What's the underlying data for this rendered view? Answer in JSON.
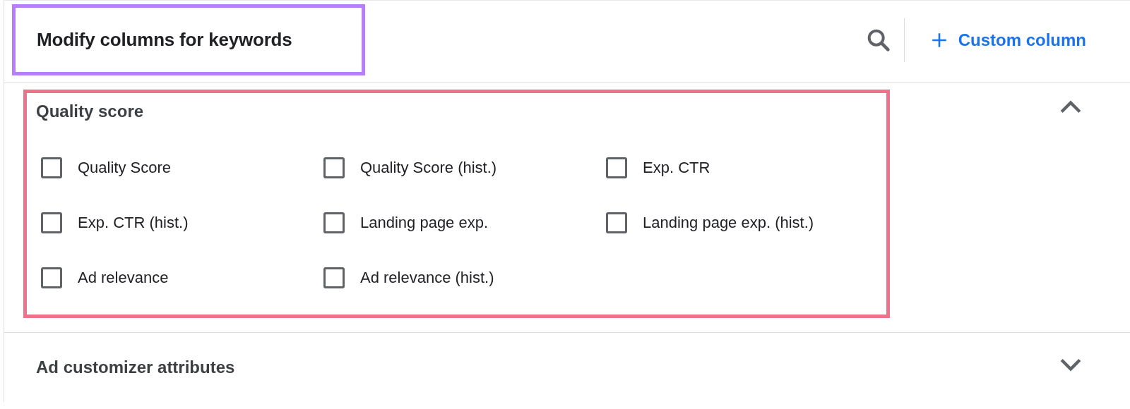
{
  "header": {
    "title": "Modify columns for keywords",
    "custom_column_button": "Custom column",
    "highlighted": true
  },
  "sections": [
    {
      "title": "Quality score",
      "expanded": true,
      "highlighted": true,
      "options": [
        {
          "label": "Quality Score",
          "checked": false
        },
        {
          "label": "Quality Score (hist.)",
          "checked": false
        },
        {
          "label": "Exp. CTR",
          "checked": false
        },
        {
          "label": "Exp. CTR (hist.)",
          "checked": false
        },
        {
          "label": "Landing page exp.",
          "checked": false
        },
        {
          "label": "Landing page exp. (hist.)",
          "checked": false
        },
        {
          "label": "Ad relevance",
          "checked": false
        },
        {
          "label": "Ad relevance (hist.)",
          "checked": false
        }
      ]
    },
    {
      "title": "Ad customizer attributes",
      "expanded": false,
      "highlighted": false
    }
  ]
}
